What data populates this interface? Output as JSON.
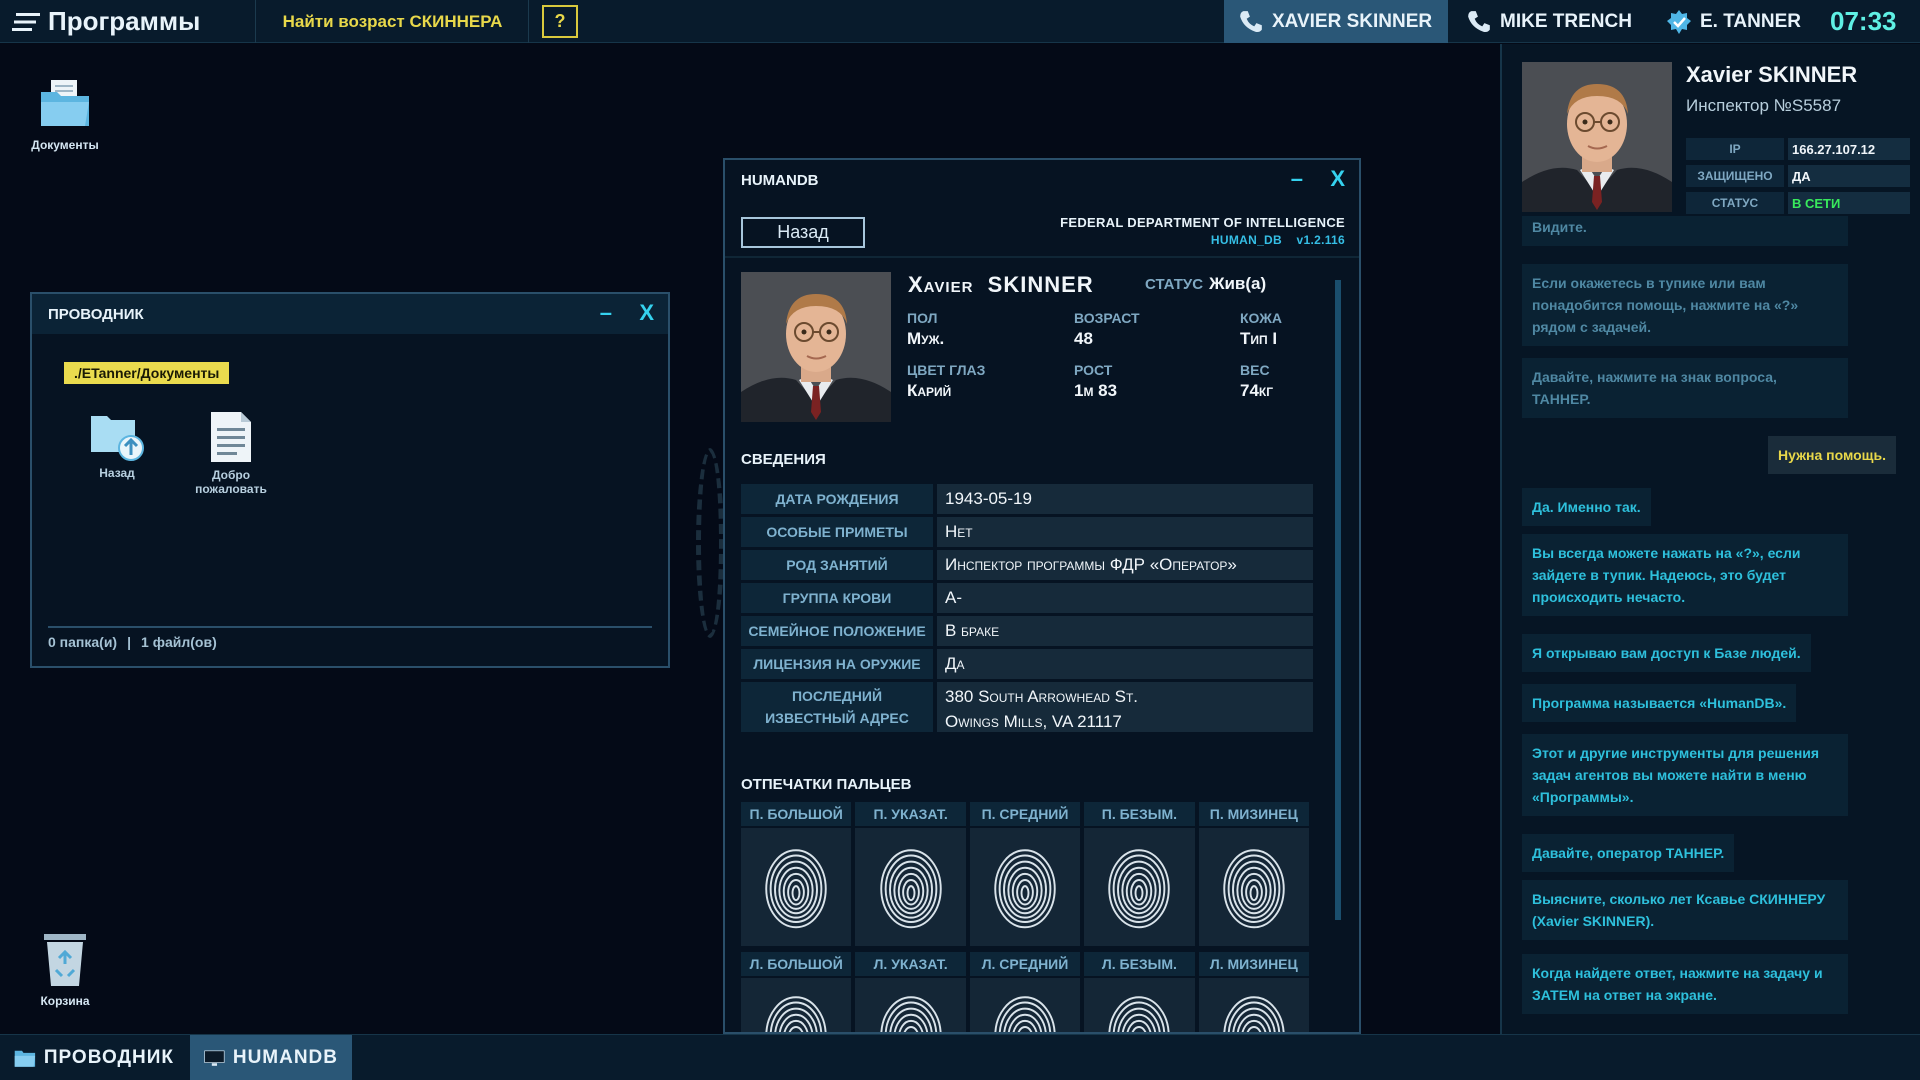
{
  "topbar": {
    "programs_label": "Программы",
    "task_label": "Найти возраст СКИННЕРА",
    "help_label": "?",
    "contacts": [
      "XAVIER SKINNER",
      "MIKE TRENCH",
      "E. TANNER"
    ],
    "clock": "07:33"
  },
  "desktop": {
    "documents_label": "Документы",
    "trash_label": "Корзина"
  },
  "explorer": {
    "title": "ПРОВОДНИК",
    "min": "–",
    "close": "X",
    "path": "./ETanner/Документы",
    "items": [
      "Назад",
      "Добро пожаловать"
    ],
    "folders": "0 папка(и)",
    "separator": "|",
    "files": "1 файл(ов)"
  },
  "humandb": {
    "title": "HUMANDB",
    "min": "–",
    "close": "X",
    "back_label": "Назад",
    "dept": "FEDERAL DEPARTMENT OF INTELLIGENCE",
    "app": "HUMAN_DB",
    "version": "v1.2.116",
    "person": {
      "first": "Xavier",
      "last": "SKINNER",
      "status_label": "СТАТУС",
      "status": "Жив(а)",
      "sex_label": "ПОЛ",
      "sex": "Муж.",
      "age_label": "ВОЗРАСТ",
      "age": "48",
      "skin_label": "КОЖА",
      "skin": "Тип I",
      "eyes_label": "ЦВЕТ ГЛАЗ",
      "eyes": "Карий",
      "height_label": "РОСТ",
      "height": "1м 83",
      "weight_label": "ВЕС",
      "weight": "74кг"
    },
    "info_title": "СВЕДЕНИЯ",
    "rows": [
      {
        "k": "ДАТА РОЖДЕНИЯ",
        "v": "1943-05-19"
      },
      {
        "k": "ОСОБЫЕ ПРИМЕТЫ",
        "v": "Нет"
      },
      {
        "k": "РОД ЗАНЯТИЙ",
        "v": "Инспектор программы ФДР «Оператор»"
      },
      {
        "k": "ГРУППА КРОВИ",
        "v": "A-"
      },
      {
        "k": "СЕМЕЙНОЕ ПОЛОЖЕНИЕ",
        "v": "В браке"
      },
      {
        "k": "ЛИЦЕНЗИЯ НА ОРУЖИЕ",
        "v": "Да"
      }
    ],
    "address_label_1": "ПОСЛЕДНИЙ",
    "address_label_2": "ИЗВЕСТНЫЙ АДРЕС",
    "address_1": "380 South Arrowhead St.",
    "address_2": "Owings Mills, VA 21117",
    "fp_title": "ОТПЕЧАТКИ ПАЛЬЦЕВ",
    "fp_right": [
      "П. БОЛЬШОЙ",
      "П. УКАЗАТ.",
      "П. СРЕДНИЙ",
      "П. БЕЗЫМ.",
      "П. МИЗИНЕЦ"
    ],
    "fp_left": [
      "Л. БОЛЬШОЙ",
      "Л. УКАЗАТ.",
      "Л. СРЕДНИЙ",
      "Л. БЕЗЫМ.",
      "Л. МИЗИНЕЦ"
    ]
  },
  "contact_panel": {
    "name": "Xavier SKINNER",
    "inspector": "Инспектор №S5587",
    "ip_label": "IP",
    "ip": "166.27.107.12",
    "secure_label": "ЗАЩИЩЕНО",
    "secure": "ДА",
    "status_label": "СТАТУС",
    "status": "В СЕТИ",
    "cut_text": "Видите.",
    "messages": [
      "Если окажетесь в тупике или вам понадобится помощь, нажмите на «?» рядом с задачей.",
      "Давайте, нажмите на знак вопроса, ТАННЕР.",
      "Нужна помощь.",
      "Да. Именно так.",
      "Вы всегда можете нажать на «?», если зайдете в тупик. Надеюсь, это будет происходить нечасто.",
      "Я открываю вам доступ к Базе людей.",
      "Программа называется «HumanDB».",
      "Этот и другие инструменты для решения задач агентов вы можете найти в меню «Программы».",
      "Давайте, оператор ТАННЕР.",
      "Выясните, сколько лет Ксавье СКИННЕРУ (Xavier SKINNER).",
      "Когда найдете ответ, нажмите на задачу и ЗАТЕМ на ответ на экране."
    ]
  },
  "taskbar": {
    "items": [
      "ПРОВОДНИК",
      "HUMANDB"
    ]
  },
  "colors": {
    "accent_cyan": "#35d2ef",
    "task_yellow": "#e8d84a",
    "online_green": "#38ea5c",
    "active_tab": "#2a5777"
  }
}
